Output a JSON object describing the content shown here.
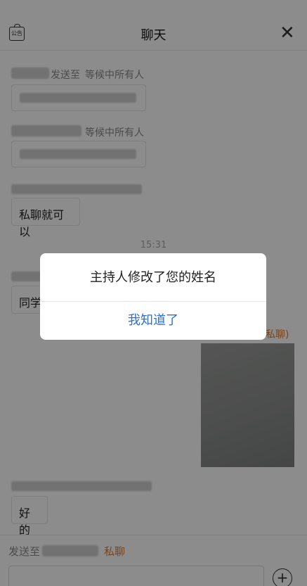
{
  "header": {
    "notice_icon_text": "公告",
    "title": "聊天",
    "close_glyph": "✕"
  },
  "messages": [
    {
      "sender_suffix": "发送至",
      "target": "等候中所有人",
      "text": ""
    },
    {
      "sender_suffix": "",
      "target": "等候中所有人",
      "text": ""
    },
    {
      "text": "私聊就可以"
    },
    {
      "time": "15:31"
    },
    {
      "text": "同学"
    },
    {
      "tag": "私聊)"
    },
    {
      "text": "好的"
    }
  ],
  "footer": {
    "send_to_label": "发送至",
    "private_label": "私聊",
    "plus_glyph": "+"
  },
  "dialog": {
    "message": "主持人修改了您的姓名",
    "button": "我知道了"
  },
  "colors": {
    "accent_blue": "#2b6fd6",
    "private_orange": "#e07b2c"
  }
}
